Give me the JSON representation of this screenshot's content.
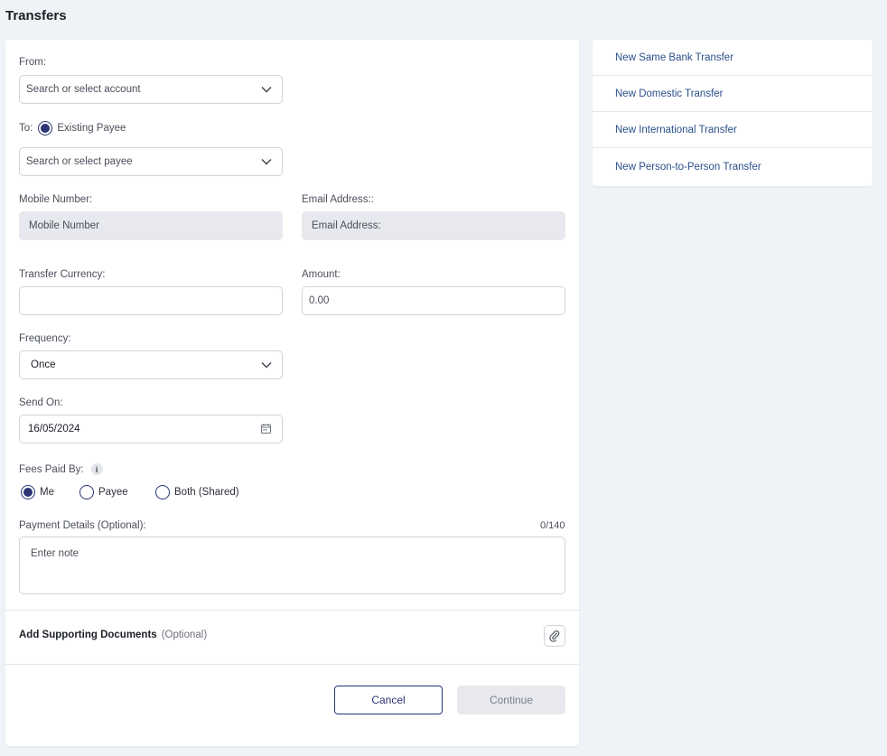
{
  "page": {
    "title": "Transfers"
  },
  "form": {
    "from": {
      "label": "From:",
      "placeholder": "Search or select account"
    },
    "to": {
      "label": "To:",
      "option": "Existing Payee",
      "placeholder": "Search or select payee"
    },
    "mobile": {
      "label": "Mobile Number:",
      "placeholder": "Mobile Number"
    },
    "email": {
      "label": "Email Address::",
      "placeholder": "Email Address:"
    },
    "currency": {
      "label": "Transfer Currency:",
      "value": ""
    },
    "amount": {
      "label": "Amount:",
      "placeholder": "0.00"
    },
    "frequency": {
      "label": "Frequency:",
      "value": "Once"
    },
    "send_on": {
      "label": "Send On:",
      "value": "16/05/2024"
    },
    "fees": {
      "label": "Fees Paid By:",
      "info_icon": "info-icon",
      "options": [
        "Me",
        "Payee",
        "Both (Shared)"
      ],
      "selected": "Me"
    },
    "payment_details": {
      "label": "Payment Details (Optional):",
      "counter": "0/140",
      "placeholder": "Enter note"
    },
    "documents": {
      "label": "Add Supporting Documents",
      "optional": "(Optional)",
      "icon": "paperclip-icon"
    },
    "buttons": {
      "cancel": "Cancel",
      "continue": "Continue"
    }
  },
  "sidebar": {
    "items": [
      {
        "label": "New Same Bank Transfer"
      },
      {
        "label": "New Domestic Transfer"
      },
      {
        "label": "New International Transfer"
      },
      {
        "label": "New Person-to-Person Transfer"
      }
    ]
  },
  "colors": {
    "accent": "#2b3574",
    "link": "#2a4f8a",
    "background": "#eff2f6",
    "disabled": "#e8e9ee"
  }
}
